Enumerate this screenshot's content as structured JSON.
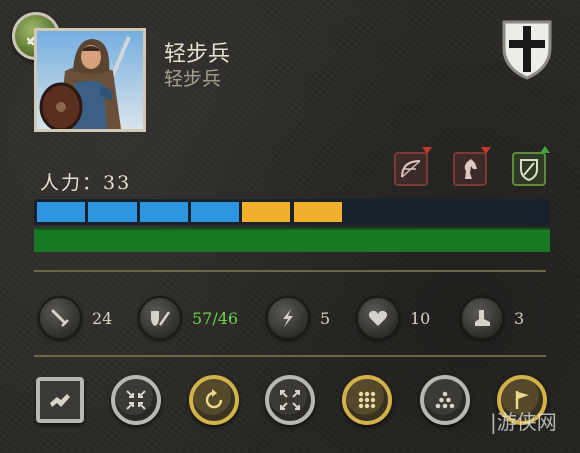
{
  "unit": {
    "name": "轻步兵",
    "type": "轻步兵"
  },
  "manpower": {
    "label": "人力：",
    "value": "33"
  },
  "manpower_bar": {
    "blue_segments": 4,
    "gold_segments": 2,
    "total_segments": 10
  },
  "health_fraction": 1.0,
  "stats": {
    "melee_attack": "24",
    "defense": "57/46",
    "charge": "5",
    "health": "10",
    "speed": "3"
  },
  "icons": {
    "badge": "sword-icon",
    "crest": "cross-shield-icon",
    "traits": [
      "bow-icon",
      "horse-icon",
      "shield-icon"
    ],
    "buttons": [
      "formation-square-icon",
      "converge-icon",
      "rotate-icon",
      "expand-icon",
      "grid-formation-icon",
      "triangle-formation-icon",
      "flag-icon"
    ]
  },
  "colors": {
    "blue": "#2e96e0",
    "gold": "#f0b02c",
    "green": "#167a25",
    "defense_text": "#6fd04e"
  },
  "watermark": "|游侠网"
}
